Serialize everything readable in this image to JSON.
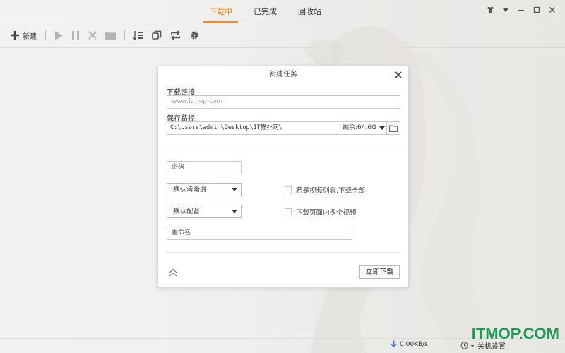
{
  "tabs": [
    {
      "label": "下载中",
      "active": true
    },
    {
      "label": "已完成",
      "active": false
    },
    {
      "label": "回收站",
      "active": false
    }
  ],
  "toolbar": {
    "new_label": "新建"
  },
  "dialog": {
    "title": "新建任务",
    "link_label": "下载链接",
    "link_value": "www.itmop.com",
    "path_label": "保存路径",
    "path_value": "C:\\Users\\admin\\Desktop\\IT猫扑网\\",
    "free_space": "剩余:64.6G",
    "password_placeholder": "密码",
    "quality_select": "默认清晰度",
    "audio_select": "默认配音",
    "rename_placeholder": "重命名",
    "check_playlist": "若是视频列表,下载全部",
    "check_multi_video": "下载页面内多个视频",
    "start_button": "立即下载"
  },
  "status": {
    "speed": "0.00KB/s",
    "shutdown": "关机设置"
  },
  "watermark": "ITMOP.COM",
  "colors": {
    "accent": "#f08a24",
    "watermark": "#1a9a55"
  }
}
